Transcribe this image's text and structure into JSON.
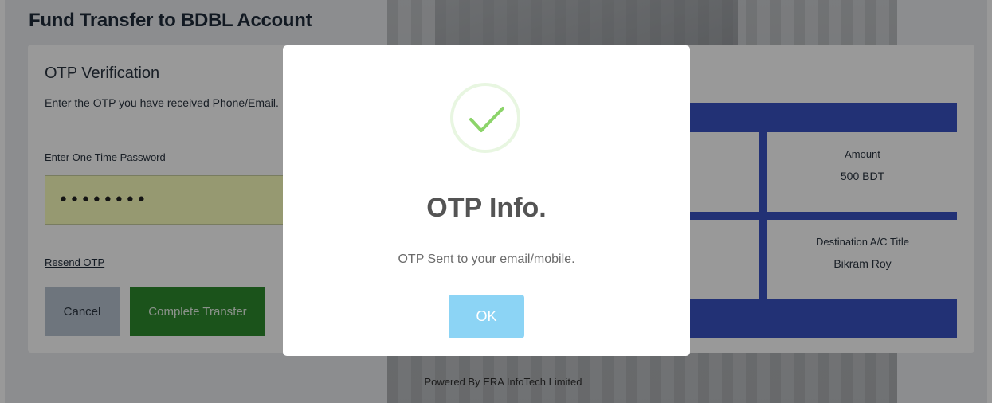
{
  "page": {
    "title": "Fund Transfer to BDBL Account",
    "footer": "Powered By ERA InfoTech Limited"
  },
  "otp_form": {
    "heading": "OTP Verification",
    "description": "Enter the OTP you have received Phone/Email.",
    "field_label": "Enter One Time Password",
    "field_value": "••••••••",
    "resend_label": "Resend OTP",
    "cancel_label": "Cancel",
    "complete_label": "Complete Transfer"
  },
  "summary": {
    "amount_label": "Amount",
    "amount_value": "500 BDT",
    "destination_title_label": "Destination A/C Title",
    "destination_title_value": "Bikram Roy"
  },
  "modal": {
    "icon": "success-check-icon",
    "title": "OTP Info.",
    "message": "OTP Sent to your email/mobile.",
    "ok_label": "OK"
  },
  "colors": {
    "success_green": "#8cd46a",
    "ok_button": "#8cd4f5",
    "panel_blue": "#3a52c4",
    "complete_button": "#2e8b2e"
  }
}
